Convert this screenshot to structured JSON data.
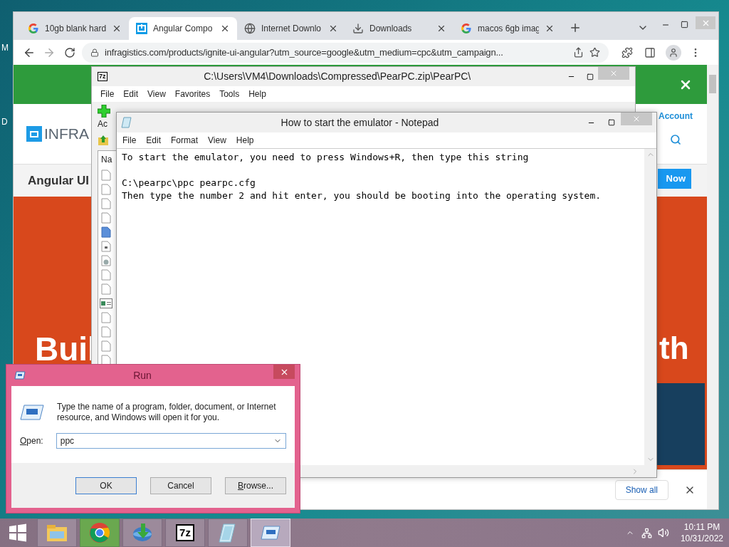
{
  "desktop": {
    "icon_labels": [
      "M",
      "D"
    ]
  },
  "browser": {
    "tabs": [
      {
        "title": "10gb blank hard",
        "kind": "google",
        "selected": false
      },
      {
        "title": "Angular Compo",
        "kind": "infragistics",
        "selected": true
      },
      {
        "title": "Internet Downlo",
        "kind": "globe",
        "selected": false
      },
      {
        "title": "Downloads",
        "kind": "download",
        "selected": false
      },
      {
        "title": "macos 6gb imag",
        "kind": "google",
        "selected": false
      }
    ],
    "url": "infragistics.com/products/ignite-ui-angular?utm_source=google&utm_medium=cpc&utm_campaign...",
    "page": {
      "logo_text": "INFRA",
      "account": "Account",
      "nav": "Angular UI",
      "cta": "Now",
      "hero_left": "Buil",
      "hero_right": "th"
    },
    "downloads_bar": {
      "show_all": "Show all"
    }
  },
  "zip_window": {
    "icon_text": "7z",
    "title": "C:\\Users\\VM4\\Downloads\\Compressed\\PearPC.zip\\PearPC\\",
    "menu": [
      "File",
      "Edit",
      "View",
      "Favorites",
      "Tools",
      "Help"
    ],
    "toolbar_label": "Ac",
    "column": "Na",
    "files": [
      {
        "kind": "doc"
      },
      {
        "kind": "doc"
      },
      {
        "kind": "doc"
      },
      {
        "kind": "doc"
      },
      {
        "kind": "text"
      },
      {
        "kind": "setup"
      },
      {
        "kind": "globe"
      },
      {
        "kind": "doc"
      },
      {
        "kind": "doc"
      },
      {
        "kind": "window"
      },
      {
        "kind": "doc"
      },
      {
        "kind": "doc"
      },
      {
        "kind": "doc"
      },
      {
        "kind": "doc"
      }
    ]
  },
  "notepad": {
    "title": "How to start the emulator - Notepad",
    "menu": [
      "File",
      "Edit",
      "Format",
      "View",
      "Help"
    ],
    "paragraphs": [
      {
        "lines": [
          "To start the emulator, you need to press Windows+R, then type this string"
        ]
      },
      {
        "lines": [
          "C:\\pearpc\\ppc pearpc.cfg",
          "Then type the number 2 and hit enter, you should be booting into the operating system."
        ]
      }
    ]
  },
  "run": {
    "title": "Run",
    "description": "Type the name of a program, folder, document, or Internet resource, and Windows will open it for you.",
    "open_label": "Open:",
    "value": "ppc",
    "buttons": [
      {
        "label": "OK",
        "default": true,
        "mnemonic": false
      },
      {
        "label": "Cancel",
        "default": false,
        "mnemonic": false
      },
      {
        "label": "Browse...",
        "default": false,
        "mnemonic": true
      }
    ]
  },
  "taskbar": {
    "apps": [
      {
        "kind": "explorer",
        "active": false
      },
      {
        "kind": "chrome",
        "active": false
      },
      {
        "kind": "idm",
        "active": false
      },
      {
        "kind": "archive",
        "active": false,
        "icon_text": "7z"
      },
      {
        "kind": "notepad",
        "active": false
      },
      {
        "kind": "run",
        "active": true
      }
    ],
    "time": "10:11 PM",
    "date": "10/31/2022"
  }
}
